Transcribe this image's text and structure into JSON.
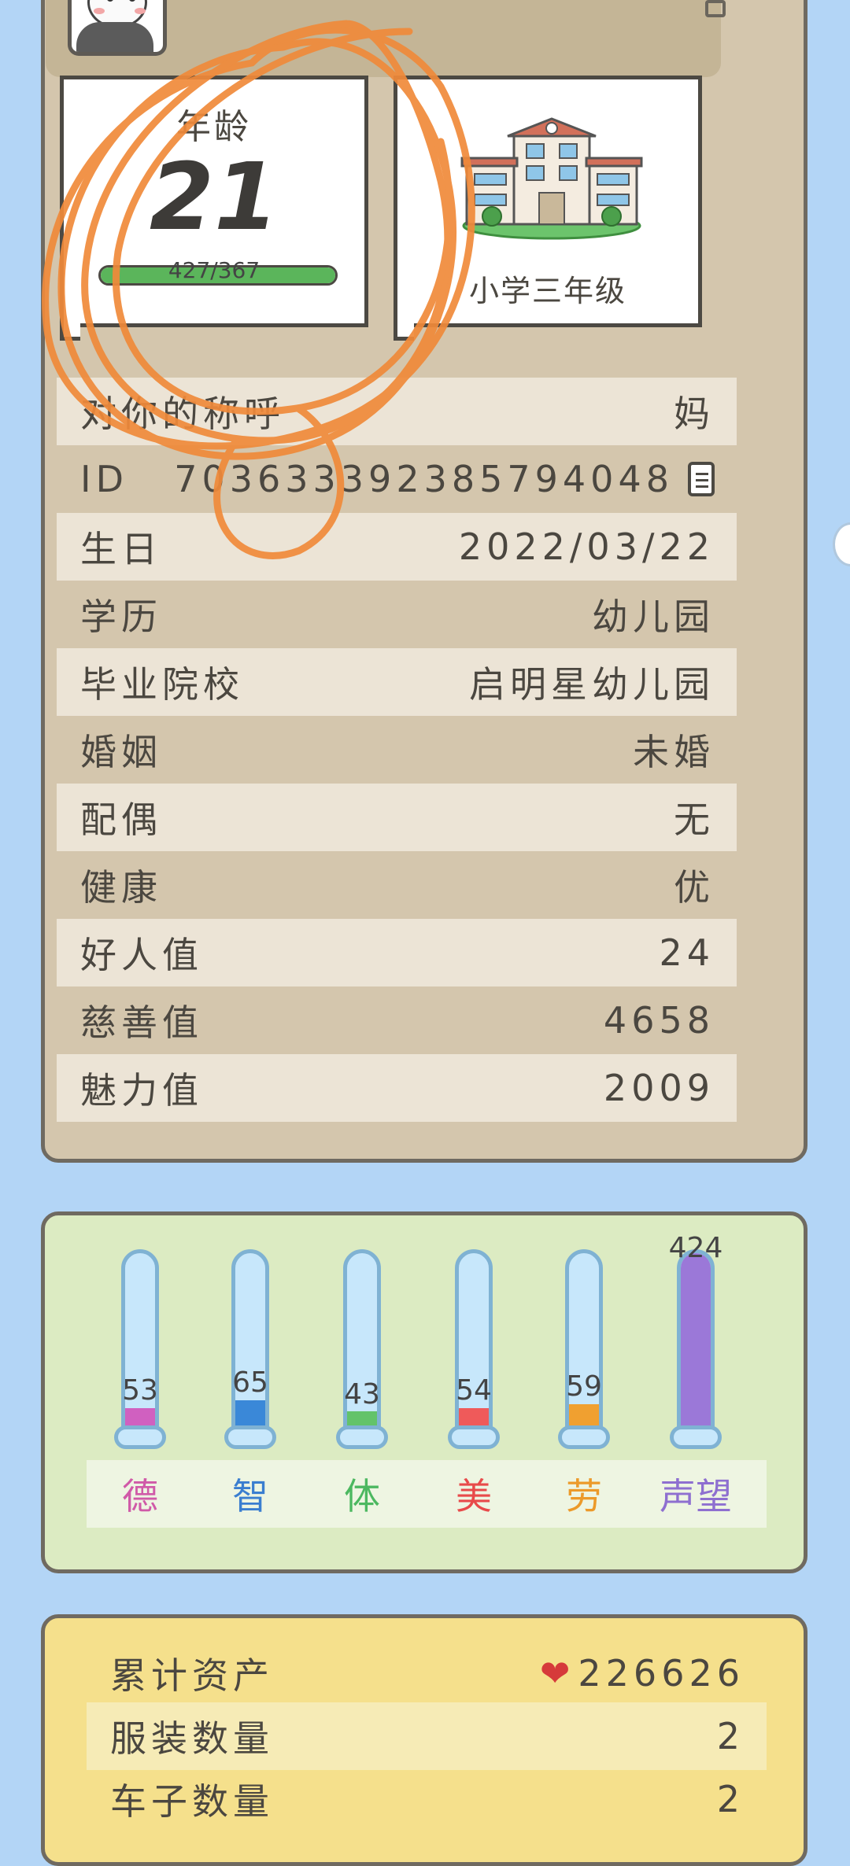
{
  "profile": {
    "age_label": "年龄",
    "age_value": "21",
    "age_exp": "427/367",
    "age_progress": 1.0,
    "school_grade": "小学三年级",
    "rows": [
      {
        "label": "对你的称呼",
        "value": "妈"
      },
      {
        "label": "ID",
        "value": "7036333923857940 48"
      },
      {
        "label": "生日",
        "value": "2022/03/22"
      },
      {
        "label": "学历",
        "value": "幼儿园"
      },
      {
        "label": "毕业院校",
        "value": "启明星幼儿园"
      },
      {
        "label": "婚姻",
        "value": "未婚"
      },
      {
        "label": "配偶",
        "value": "无"
      },
      {
        "label": "健康",
        "value": "优"
      },
      {
        "label": "好人值",
        "value": "24"
      },
      {
        "label": "慈善值",
        "value": "4658"
      },
      {
        "label": "魅力值",
        "value": "2009"
      }
    ],
    "id_display": "703633392385794048"
  },
  "stats": {
    "items": [
      {
        "label": "德",
        "value": "53",
        "color": "#d060c0",
        "text_color": "#d05aa8",
        "fill": 0.16
      },
      {
        "label": "智",
        "value": "65",
        "color": "#3a88d8",
        "text_color": "#3a7ed0",
        "fill": 0.2
      },
      {
        "label": "体",
        "value": "43",
        "color": "#63c36a",
        "text_color": "#4cb860",
        "fill": 0.14
      },
      {
        "label": "美",
        "value": "54",
        "color": "#ef5a5a",
        "text_color": "#e84a4a",
        "fill": 0.16
      },
      {
        "label": "劳",
        "value": "59",
        "color": "#f0a030",
        "text_color": "#ec9a2a",
        "fill": 0.18
      },
      {
        "label": "声望",
        "value": "424",
        "color": "#9b78d8",
        "text_color": "#8e6fd0",
        "fill": 1.0
      }
    ]
  },
  "assets": {
    "rows": [
      {
        "label": "累计资产",
        "value": "226626"
      },
      {
        "label": "服装数量",
        "value": "2"
      },
      {
        "label": "车子数量",
        "value": "2"
      }
    ]
  },
  "icons": {
    "copy": "copy-icon",
    "heart": "heart-icon",
    "edit": "edit-icon"
  }
}
